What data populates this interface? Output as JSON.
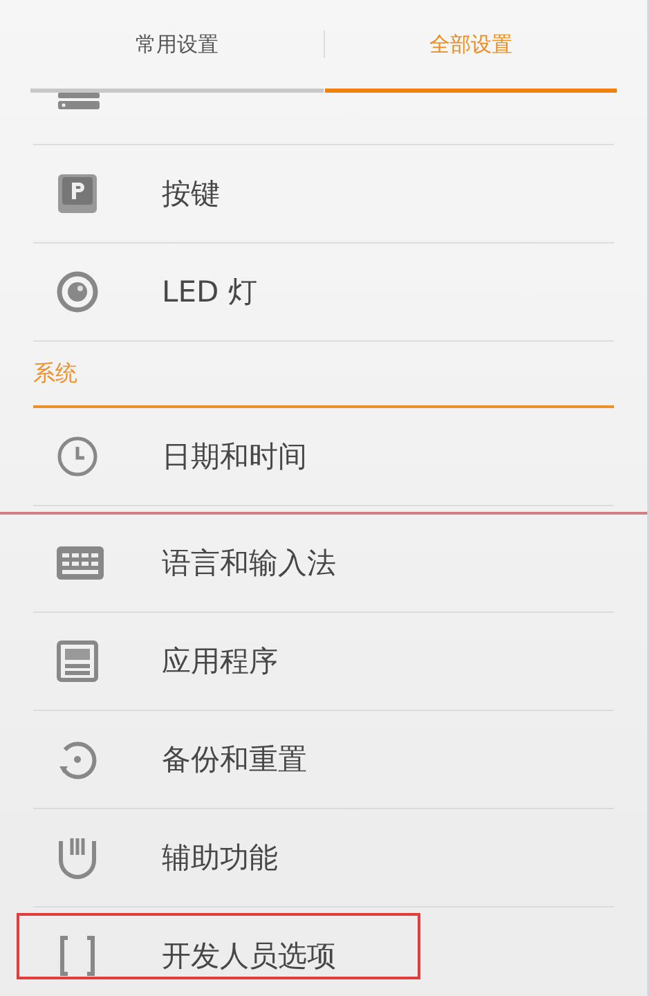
{
  "tabs": [
    {
      "label": "常用设置",
      "selected": false
    },
    {
      "label": "全部设置",
      "selected": true
    }
  ],
  "list": [
    {
      "kind": "cut_row"
    },
    {
      "kind": "row",
      "label": "按键",
      "highlighted": false
    },
    {
      "kind": "row",
      "label": "LED 灯",
      "highlighted": false
    },
    {
      "kind": "section",
      "label": "系统"
    },
    {
      "kind": "row",
      "label": "日期和时间",
      "highlighted": false
    },
    {
      "kind": "seam"
    },
    {
      "kind": "row",
      "label": "语言和输入法",
      "highlighted": false
    },
    {
      "kind": "row",
      "label": "应用程序",
      "highlighted": false
    },
    {
      "kind": "row",
      "label": "备份和重置",
      "highlighted": false
    },
    {
      "kind": "row",
      "label": "辅助功能",
      "highlighted": false
    },
    {
      "kind": "row",
      "label": "开发人员选项",
      "highlighted": true
    }
  ]
}
